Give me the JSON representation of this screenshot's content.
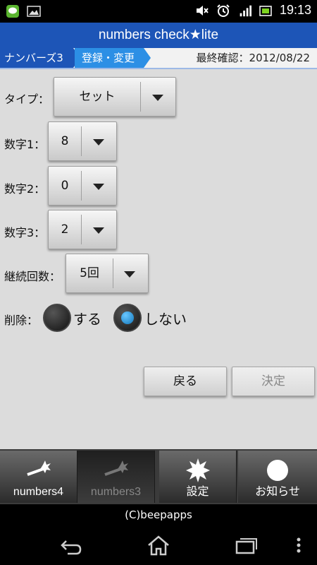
{
  "status_bar": {
    "time": "19:13",
    "left_icons": [
      "line-app-icon",
      "image-icon"
    ],
    "right_icons": [
      "mute-icon",
      "alarm-icon",
      "lte-signal-icon",
      "battery-icon"
    ]
  },
  "app": {
    "title": "numbers check★lite"
  },
  "breadcrumb": {
    "item1": "ナンバーズ3",
    "item2": "登録・変更",
    "last_check": "最終確認：2012/08/22"
  },
  "form": {
    "type_label": "タイプ：",
    "type_value": "セット",
    "digit1_label": "数字1：",
    "digit1_value": "8",
    "digit2_label": "数字2：",
    "digit2_value": "0",
    "digit3_label": "数字3：",
    "digit3_value": "2",
    "repeat_label": "継続回数：",
    "repeat_value": "5回",
    "delete_label": "削除：",
    "delete_yes": "する",
    "delete_no": "しない",
    "delete_selected": "しない"
  },
  "buttons": {
    "back": "戻る",
    "decide": "決定"
  },
  "tabs": [
    {
      "label": "numbers4",
      "icon": "numbers4-icon"
    },
    {
      "label": "numbers3",
      "icon": "numbers3-icon"
    },
    {
      "label": "設定",
      "icon": "settings-burst-icon"
    },
    {
      "label": "お知らせ",
      "icon": "notice-circle-icon"
    }
  ],
  "footer": {
    "copyright": "(C)beepapps"
  },
  "colors": {
    "title_bar": "#1d55b7",
    "crumb_active": "#2c8fe5",
    "radio_selected": "#1377bb"
  }
}
